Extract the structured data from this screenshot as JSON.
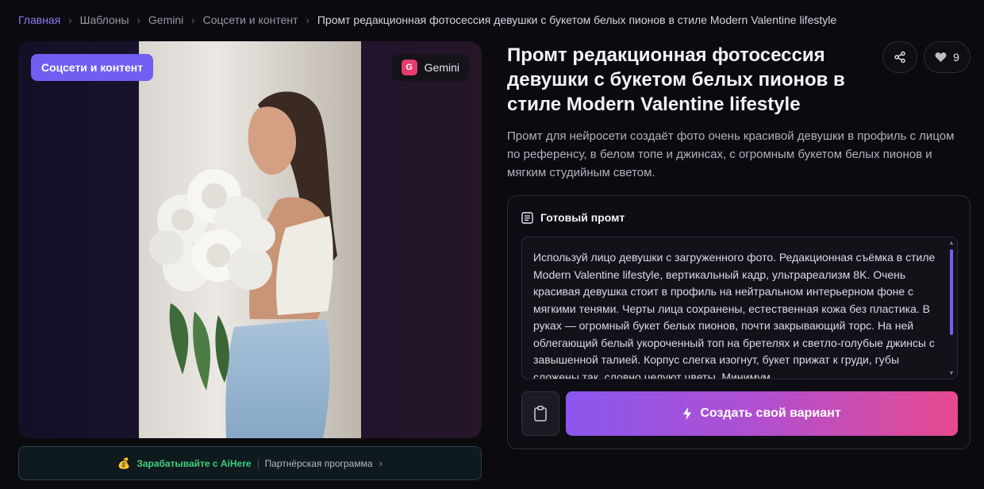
{
  "breadcrumb": {
    "items": [
      "Главная",
      "Шаблоны",
      "Gemini",
      "Соцсети и контент"
    ],
    "current": "Промт редакционная фотосессия девушки с букетом белых пионов в стиле Modern Valentine lifestyle"
  },
  "image_card": {
    "category_badge": "Соцсети и контент",
    "model_badge": {
      "icon_letter": "G",
      "label": "Gemini"
    }
  },
  "affiliate": {
    "icon": "money-bag-icon",
    "earn_label": "Зарабатывайте с AiHere",
    "partner_label": "Партнёрская программа"
  },
  "title": "Промт редакционная фотосессия девушки с букетом белых пионов в стиле Modern Valentine lifestyle",
  "actions": {
    "like_count": "9"
  },
  "description": "Промт для нейросети создаёт фото очень красивой девушки в профиль с лицом по референсу, в белом топе и джинсах, с огромным букетом белых пионов и мягким студийным светом.",
  "prompt": {
    "header": "Готовый промт",
    "text": "Используй лицо девушки с загруженного фото. Редакционная съёмка в стиле Modern Valentine lifestyle, вертикальный кадр, ультрареализм 8K. Очень красивая девушка  стоит в профиль на нейтральном интерьерном фоне с мягкими тенями. Черты лица сохранены, естественная кожа без пластика. В руках — огромный букет белых пионов, почти закрывающий торс. На ней облегающий белый укороченный топ на бретелях и светло-голубые джинсы с завышенной талией. Корпус слегка изогнут, букет прижат к груди, губы сложены так, словно целуют цветы. Минимум",
    "create_button": "Создать свой вариант"
  },
  "colors": {
    "accent": "#6f5ef0",
    "gradient_start": "#8a57ee",
    "gradient_end": "#e64a8f",
    "earn_green": "#3fd07e"
  }
}
